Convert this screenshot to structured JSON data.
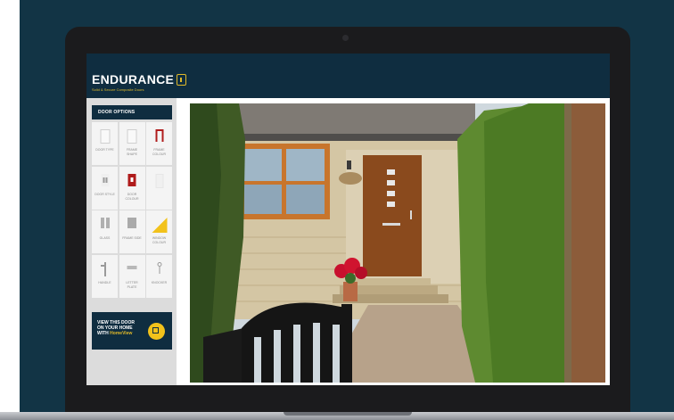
{
  "app": {
    "logo_title": "ENDURANCE",
    "logo_subtitle": "Solid & Secure Composite Doors"
  },
  "sidebar": {
    "title": "DOOR OPTIONS",
    "options": [
      {
        "label": "DOOR TYPE",
        "icon": "door-type-icon"
      },
      {
        "label": "FRAME SHAPE",
        "icon": "frame-shape-icon"
      },
      {
        "label": "FRAME COLOUR",
        "icon": "frame-colour-icon"
      },
      {
        "label": "DOOR STYLE",
        "icon": "door-style-icon"
      },
      {
        "label": "DOOR COLOUR",
        "icon": "door-colour-icon"
      },
      {
        "label": "",
        "icon": "faint-door-icon"
      },
      {
        "label": "GLASS",
        "icon": "glass-icon"
      },
      {
        "label": "FRAME SIDE",
        "icon": "frame-side-icon"
      },
      {
        "label": "WINDOW COLOUR",
        "icon": "window-colour-icon"
      },
      {
        "label": "HANDLE",
        "icon": "handle-icon"
      },
      {
        "label": "LETTER PLATE",
        "icon": "letter-plate-icon"
      },
      {
        "label": "KNOCKER",
        "icon": "knocker-icon"
      }
    ]
  },
  "homeview": {
    "line1": "VIEW THIS DOOR",
    "line2": "ON YOUR HOME",
    "line3_prefix": "WITH ",
    "line3_accent": "HomeView"
  },
  "colors": {
    "navy": "#0f2d40",
    "accent_yellow": "#f2c21b",
    "door_wood": "#8a4a1d",
    "frame_red": "#b01c1c"
  }
}
